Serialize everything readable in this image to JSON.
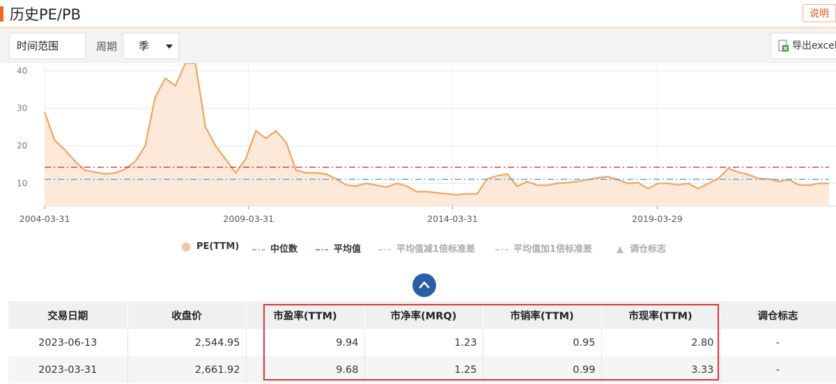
{
  "header": {
    "title": "历史PE/PB",
    "help_label": "说明"
  },
  "toolbar": {
    "range_label": "时间范围",
    "period_label": "周期",
    "period_value": "季",
    "export_label": "导出excel"
  },
  "colors": {
    "accent": "#f26a1b",
    "pe_line": "#f3a45c",
    "pe_fill": "#fde9d9",
    "median": "#4aa9e0",
    "mean": "#e0303a",
    "highlight": "#e0303a",
    "collapse_button": "#2b5fa5"
  },
  "chart_data": {
    "type": "area",
    "series": [
      {
        "name": "PE(TTM)",
        "values": [
          29,
          21.5,
          19,
          16,
          13.5,
          13,
          12.5,
          12.8,
          13.8,
          15.8,
          20,
          33,
          38,
          36,
          42,
          42,
          25,
          20,
          16.5,
          12.8,
          16.5,
          24,
          22,
          24,
          21,
          13.5,
          12.8,
          12.8,
          12.5,
          11.2,
          9.5,
          9.3,
          10,
          9.5,
          9,
          10,
          9.3,
          7.8,
          7.8,
          7.5,
          7.2,
          7,
          7.2,
          7.2,
          11.2,
          12,
          12.5,
          9.2,
          10.5,
          9.5,
          9.5,
          10,
          10.2,
          10.5,
          11,
          11.5,
          11.8,
          11,
          10,
          10.2,
          8.6,
          10,
          10,
          9.6,
          10,
          8.6,
          10,
          11.3,
          14,
          13,
          12.3,
          11.3,
          11.2,
          10.5,
          11,
          9.6,
          9.5,
          10,
          10
        ]
      },
      {
        "name": "中位数",
        "constant": 11.1
      },
      {
        "name": "平均值",
        "constant": 14.3
      }
    ],
    "x_tick_labels": [
      "2004-03-31",
      "2009-03-31",
      "2014-03-31",
      "2019-03-29"
    ],
    "y_ticks": [
      10,
      20,
      30,
      40
    ],
    "ylim": [
      4,
      42
    ],
    "grid": true,
    "legend": {
      "position": "bottom",
      "items": [
        {
          "label": "PE(TTM)",
          "marker": "circle",
          "color": "#f3c7a4",
          "enabled": true
        },
        {
          "label": "中位数",
          "marker": "dash-dot",
          "color": "#4aa9e0",
          "enabled": true
        },
        {
          "label": "平均值",
          "marker": "dash-dot",
          "color": "#e0303a",
          "enabled": true
        },
        {
          "label": "平均值减1倍标准差",
          "marker": "dash-dot",
          "color": "#bbbbbb",
          "enabled": false
        },
        {
          "label": "平均值加1倍标准差",
          "marker": "dash-dot",
          "color": "#bbbbbb",
          "enabled": false
        },
        {
          "label": "调仓标志",
          "marker": "triangle",
          "color": "#bbbbbb",
          "enabled": false
        }
      ]
    }
  },
  "table": {
    "headers": [
      "交易日期",
      "收盘价",
      "市盈率(TTM)",
      "市净率(MRQ)",
      "市销率(TTM)",
      "市现率(TTM)",
      "调仓标志"
    ],
    "rows": [
      [
        "2023-06-13",
        "2,544.95",
        "9.94",
        "1.23",
        "0.95",
        "2.80",
        "-"
      ],
      [
        "2023-03-31",
        "2,661.92",
        "9.68",
        "1.25",
        "0.99",
        "3.33",
        "-"
      ]
    ]
  }
}
